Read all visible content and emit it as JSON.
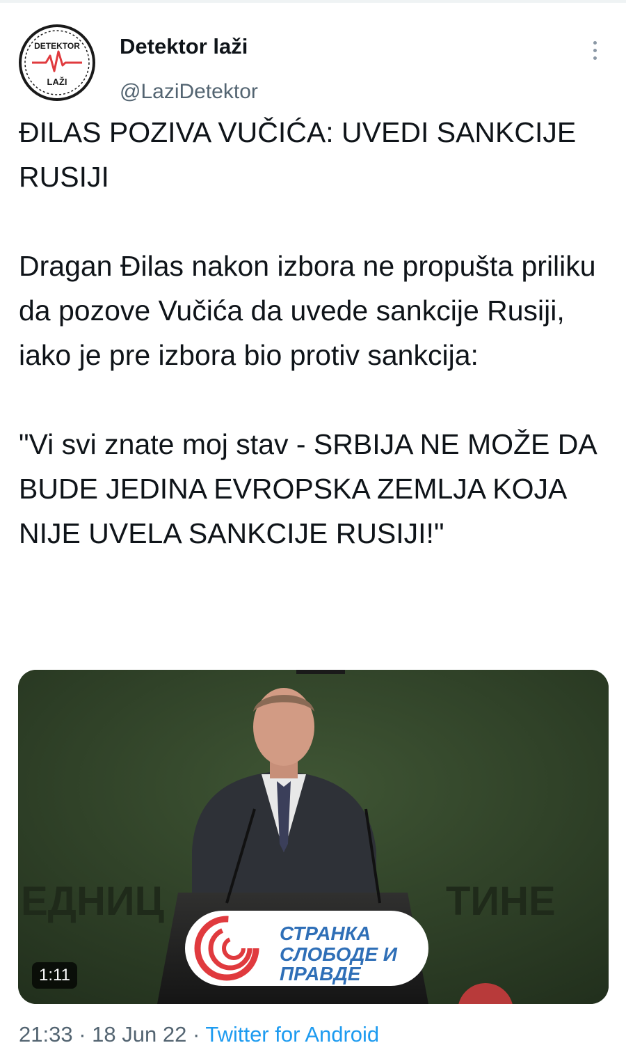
{
  "author": {
    "display_name": "Detektor laži",
    "handle": "@LaziDetektor",
    "avatar_text_top": "DETEKTOR",
    "avatar_text_bottom": "LAŽI"
  },
  "tweet": {
    "headline": "ĐILAS POZIVA VUČIĆA: UVEDI SANKCIJE RUSIJI",
    "body": "Dragan Đilas nakon izbora ne propušta priliku da pozove Vučića da uvede sankcije Rusiji, iako je pre izbora bio protiv sankcija:",
    "quote": "\"Vi svi znate moj stav - SRBIJA NE MOŽE DA BUDE JEDINA EVROPSKA ZEMLJA KOJA NIJE UVELA SANKCIJE RUSIJI!\""
  },
  "media": {
    "type": "video",
    "duration": "1:11",
    "backdrop_text_left": "ЕДНИЦ",
    "backdrop_text_right": "ТИНЕ",
    "podium_line1": "СТРАНКА",
    "podium_line2": "СЛОБОДЕ И",
    "podium_line3": "ПРАВДЕ"
  },
  "meta": {
    "time": "21:33",
    "separator": "·",
    "date": "18 Jun 22",
    "source": "Twitter for Android"
  },
  "colors": {
    "text": "#0f1419",
    "secondary": "#536471",
    "link": "#1d9bf0",
    "logo_red": "#e03a3e",
    "backdrop_green": "#33452c"
  }
}
